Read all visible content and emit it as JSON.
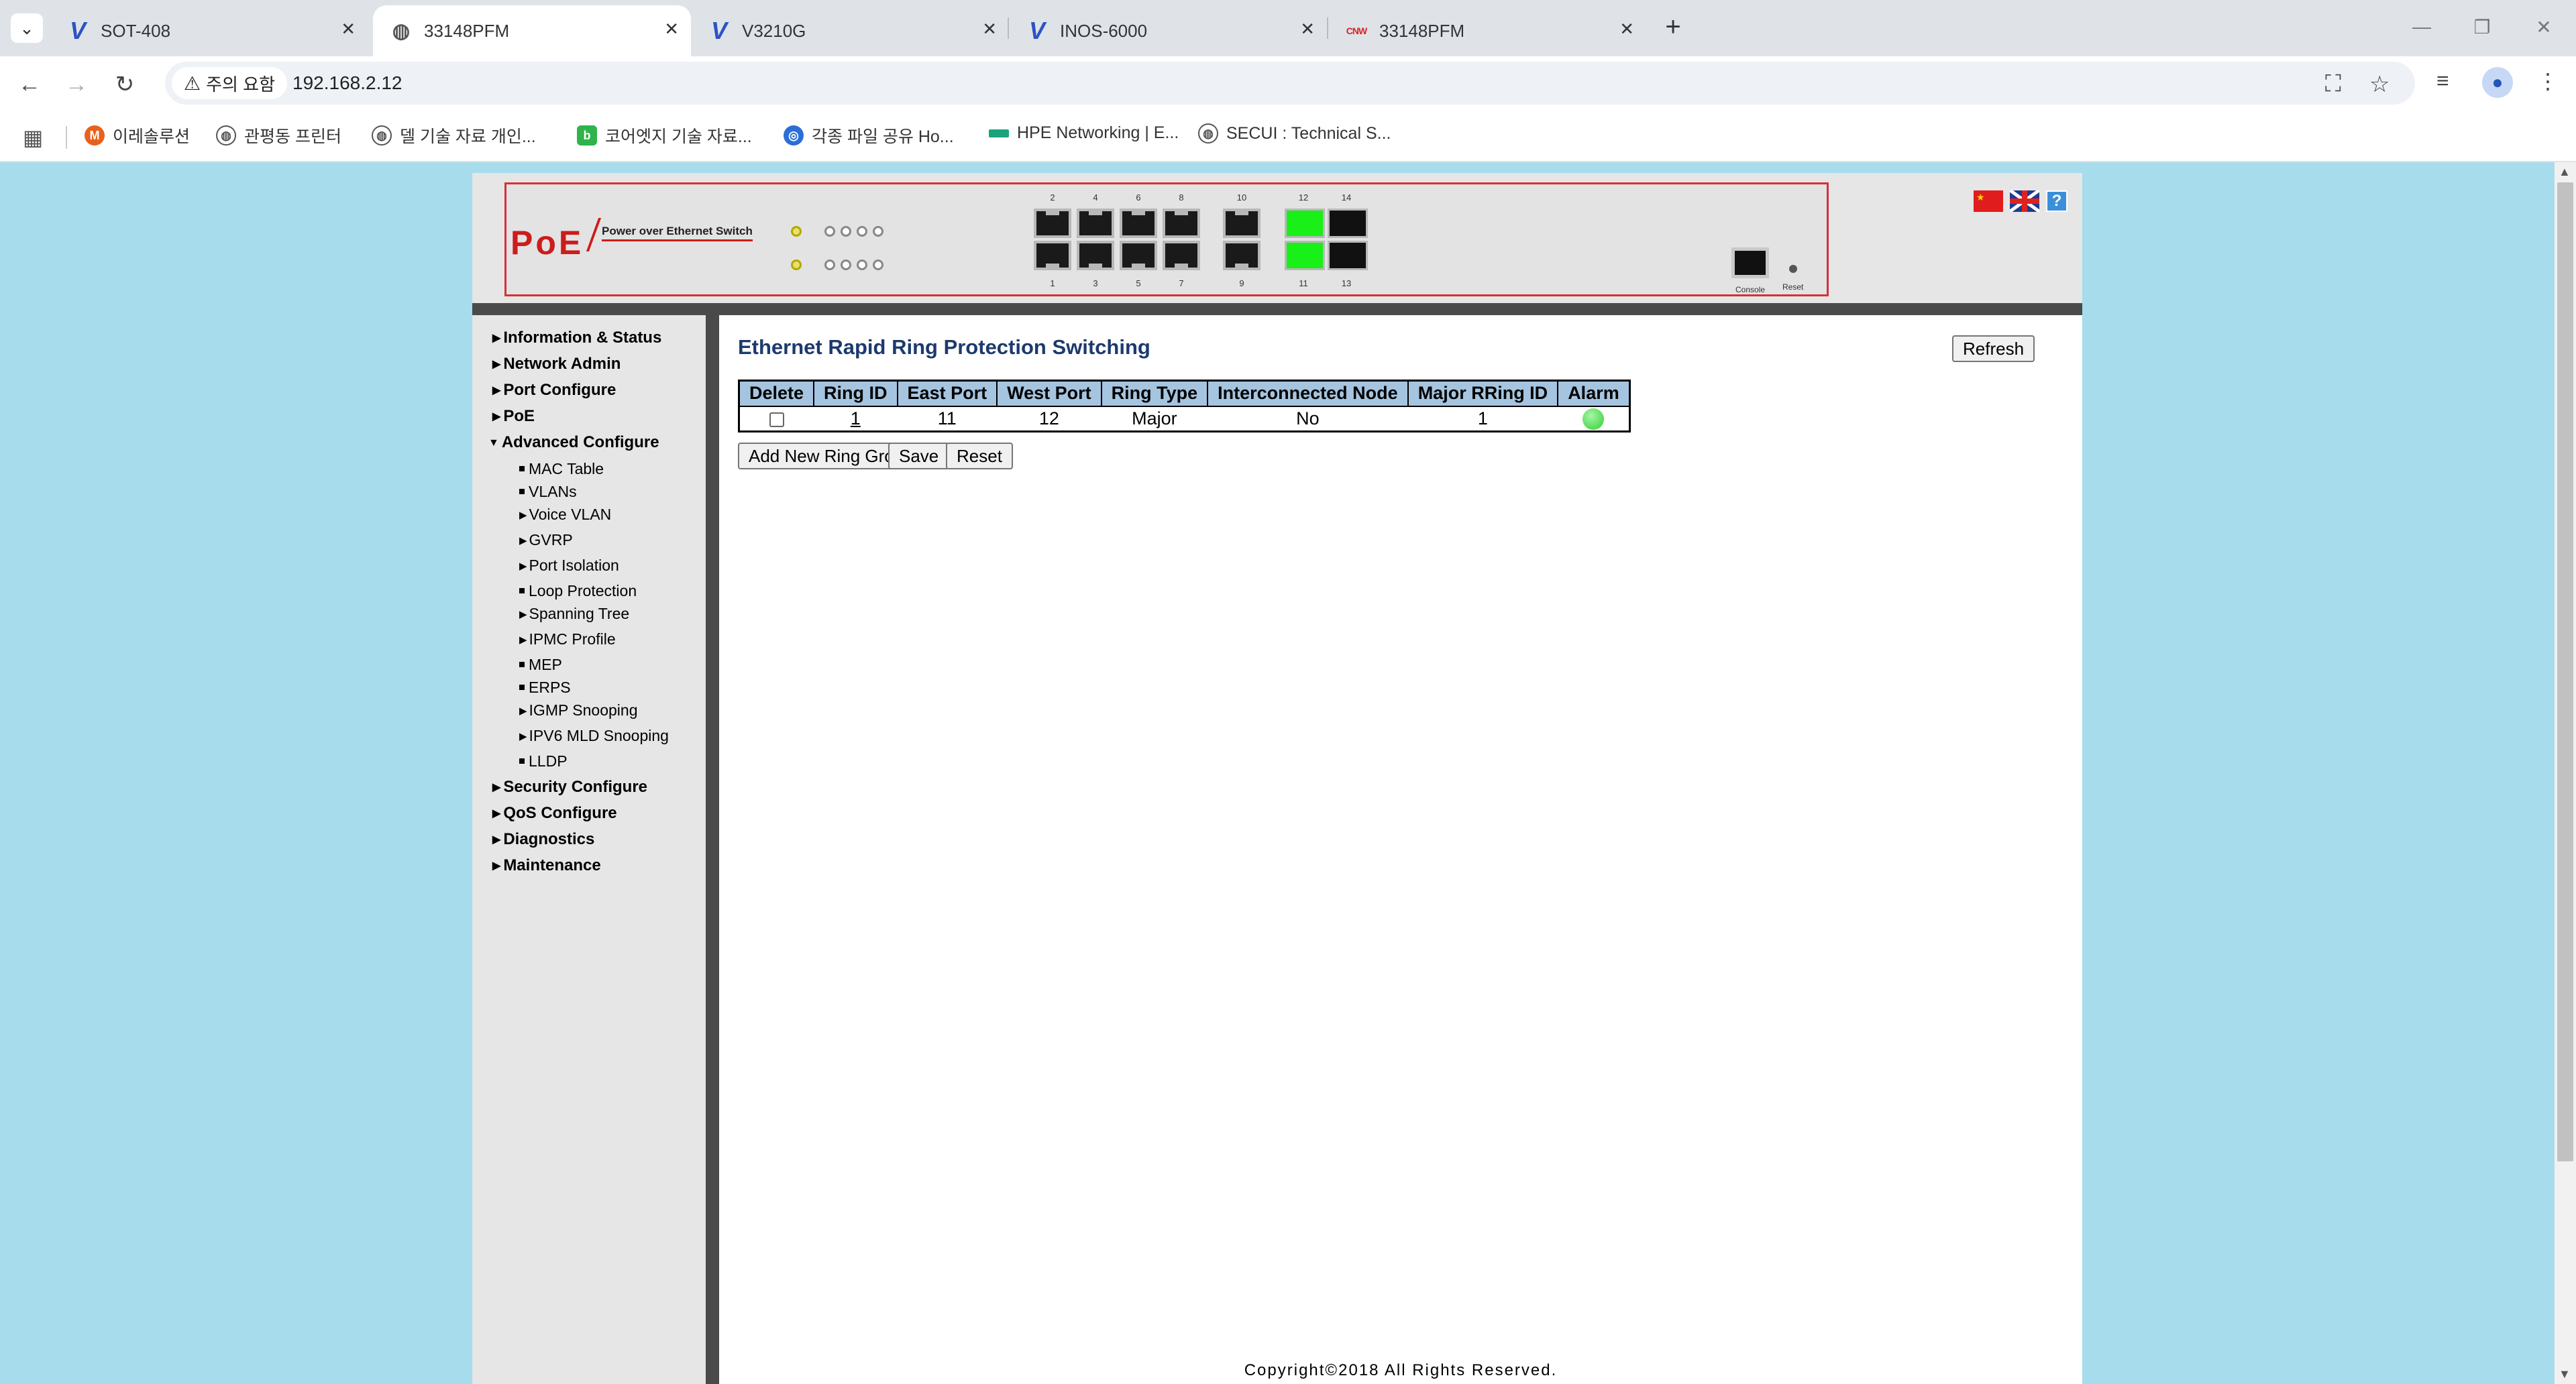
{
  "browser": {
    "tabs": [
      {
        "title": "SOT-408",
        "icon": "v-logo-icon"
      },
      {
        "title": "33148PFM",
        "icon": "globe-icon",
        "active": true
      },
      {
        "title": "V3210G",
        "icon": "v-logo-icon"
      },
      {
        "title": "INOS-6000",
        "icon": "v-logo-icon"
      },
      {
        "title": "33148PFM",
        "icon": "cnw-logo-icon"
      }
    ],
    "security_chip": "주의 요함",
    "url": "192.168.2.12",
    "bookmarks": [
      {
        "label": "이레솔루션",
        "color": "#e8611c"
      },
      {
        "label": "관평동 프린터",
        "color": "#555555"
      },
      {
        "label": "델 기술 자료 개인...",
        "color": "#555555"
      },
      {
        "label": "코어엣지 기술 자료...",
        "color": "#2fb34a"
      },
      {
        "label": "각종 파일 공유 Ho...",
        "color": "#2b6fd6"
      },
      {
        "label": "HPE Networking | E...",
        "color": "#1aa37a"
      },
      {
        "label": "SECUI : Technical S...",
        "color": "#555555"
      }
    ]
  },
  "device": {
    "logo": "PoE",
    "subtitle": "Power over Ethernet Switch",
    "ports_top": [
      "2",
      "4",
      "6",
      "8",
      "10",
      "12",
      "14"
    ],
    "ports_bottom": [
      "1",
      "3",
      "5",
      "7",
      "9",
      "11",
      "13"
    ],
    "console_label": "Console",
    "reset_label": "Reset",
    "help_label": "?"
  },
  "sidebar": {
    "menus_top": [
      {
        "label": "Information & Status"
      },
      {
        "label": "Network Admin"
      },
      {
        "label": "Port Configure"
      },
      {
        "label": "PoE"
      }
    ],
    "advanced": {
      "label": "Advanced Configure"
    },
    "advanced_items": [
      {
        "label": "MAC Table",
        "kind": "leaf"
      },
      {
        "label": "VLANs",
        "kind": "leaf"
      },
      {
        "label": "Voice VLAN",
        "kind": "folder"
      },
      {
        "label": "GVRP",
        "kind": "folder"
      },
      {
        "label": "Port Isolation",
        "kind": "folder"
      },
      {
        "label": "Loop Protection",
        "kind": "leaf"
      },
      {
        "label": "Spanning Tree",
        "kind": "folder"
      },
      {
        "label": "IPMC Profile",
        "kind": "folder"
      },
      {
        "label": "MEP",
        "kind": "leaf"
      },
      {
        "label": "ERPS",
        "kind": "leaf"
      },
      {
        "label": "IGMP Snooping",
        "kind": "folder"
      },
      {
        "label": "IPV6 MLD Snooping",
        "kind": "folder"
      },
      {
        "label": "LLDP",
        "kind": "leaf"
      }
    ],
    "menus_bottom": [
      {
        "label": "Security Configure"
      },
      {
        "label": "QoS Configure"
      },
      {
        "label": "Diagnostics"
      },
      {
        "label": "Maintenance"
      }
    ]
  },
  "main": {
    "title": "Ethernet Rapid Ring Protection Switching",
    "refresh_label": "Refresh",
    "table": {
      "headers": [
        "Delete",
        "Ring ID",
        "East Port",
        "West Port",
        "Ring Type",
        "Interconnected Node",
        "Major RRing ID",
        "Alarm"
      ],
      "rows": [
        {
          "ring_id": "1",
          "east_port": "11",
          "west_port": "12",
          "ring_type": "Major",
          "interconnected": "No",
          "major_rring_id": "1",
          "alarm_color": "#2fce2f"
        }
      ]
    },
    "add_label": "Add New Ring Group",
    "save_label": "Save",
    "reset_label": "Reset",
    "copyright": "Copyright©2018 All Rights Reserved."
  }
}
